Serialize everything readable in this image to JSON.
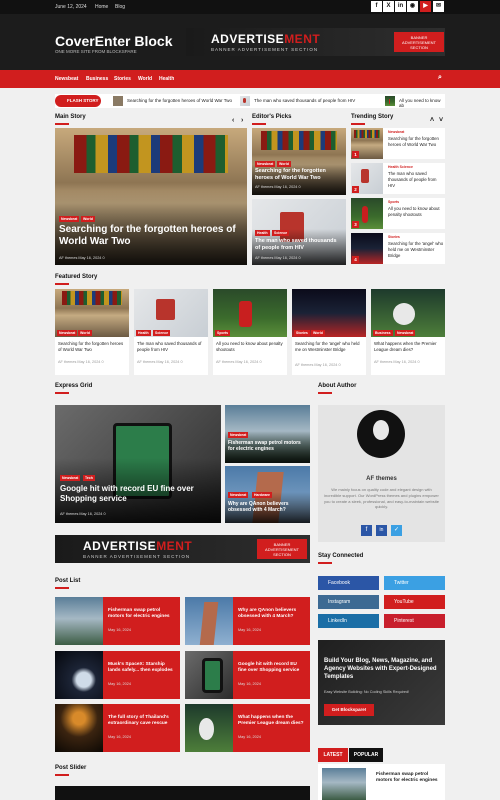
{
  "topbar": {
    "date": "June 12, 2024",
    "links": [
      "Home",
      "Blog"
    ],
    "social": [
      "f",
      "X",
      "in",
      "◉",
      "▶",
      "✉"
    ]
  },
  "site": {
    "title": "CoverEnter Block",
    "tagline": "ONE MORE SITE FROM BLOCKSPARE"
  },
  "ad": {
    "word1": "ADVERTISE",
    "word2": "MENT",
    "sub": "BANNER ADVERTISEMENT SECTION",
    "badge": "BANNER ADVERTISEMENT SECTION"
  },
  "nav": {
    "items": [
      "Newsbeat",
      "Business",
      "Stories",
      "World",
      "Health"
    ]
  },
  "ticker": {
    "label": "FLASH STORY",
    "items": [
      "Searching for the forgotten heroes of World War Two",
      "The man who saved thousands of people from HIV",
      "All you need to know ab"
    ]
  },
  "sections": {
    "main_story": "Main Story",
    "editors_picks": "Editor's Picks",
    "trending": "Trending Story",
    "featured": "Featured Story",
    "express": "Express Grid",
    "about": "About Author",
    "stay": "Stay Connected",
    "post_list": "Post List",
    "post_slider": "Post Slider"
  },
  "main_story": {
    "tags": [
      "Newsbeat",
      "World"
    ],
    "title": "Searching for the forgotten heroes of World War Two",
    "meta": "AF themes   May 16, 2024   0"
  },
  "editors": [
    {
      "tags": [
        "Newsbeat",
        "World"
      ],
      "title": "Searching for the forgotten heroes of World War Two",
      "meta": "AF themes   May 16, 2024   0"
    },
    {
      "tags": [
        "Health",
        "Science"
      ],
      "title": "The man who saved thousands of people from HIV",
      "meta": "AF themes   May 16, 2024   0"
    }
  ],
  "trending": [
    {
      "num": "1",
      "tag": "Newsbeat",
      "title": "Searching for the forgotten heroes of World War Two"
    },
    {
      "num": "2",
      "tag": "Health Science",
      "title": "The man who saved thousands of people from HIV"
    },
    {
      "num": "3",
      "tag": "Sports",
      "title": "All you need to know about penalty shootouts"
    },
    {
      "num": "4",
      "tag": "Stories",
      "title": "Searching for the 'angel' who held me on Westminster Bridge"
    }
  ],
  "featured": [
    {
      "tags": [
        "Newsbeat",
        "World"
      ],
      "title": "Searching for the forgotten heroes of World War Two",
      "meta": "AF themes   May 16, 2024   0"
    },
    {
      "tags": [
        "Health",
        "Science"
      ],
      "title": "The man who saved thousands of people from HIV",
      "meta": "AF themes   May 16, 2024   0"
    },
    {
      "tags": [
        "Sports"
      ],
      "title": "All you need to know about penalty shootouts",
      "meta": "AF themes   May 16, 2024   0"
    },
    {
      "tags": [
        "Stories",
        "World"
      ],
      "title": "Searching for the 'angel' who held me on Westminster Bridge",
      "meta": "AF themes   May 16, 2024   0"
    },
    {
      "tags": [
        "Business",
        "Newsbeat"
      ],
      "title": "What happens when the Premier League dream dies?",
      "meta": "AF themes   May 16, 2024   0"
    }
  ],
  "express": {
    "main": {
      "tags": [
        "Newsbeat",
        "Tech"
      ],
      "title": "Google hit with record EU fine over Shopping service",
      "meta": "AF themes   May 16, 2024   0"
    },
    "side": [
      {
        "tags": [
          "Newsbeat"
        ],
        "title": "Fisherman swap petrol motors for electric engines"
      },
      {
        "tags": [
          "Newsbeat",
          "Hardware"
        ],
        "title": "Why are QAnon believers obsessed with 4 March?"
      }
    ]
  },
  "author": {
    "name": "AF themes",
    "bio": "We mainly focus on quality code and elegant design with incredible support. Our WordPress themes and plugins empower you to create a sleek, professional, and easy-to-maintain website quickly."
  },
  "stay": {
    "buttons": [
      "Facebook",
      "Twitter",
      "Instagram",
      "YouTube",
      "LinkedIn",
      "Pinterest"
    ]
  },
  "promo": {
    "title": "Build Your Blog, News, Magazine, and Agency Websites with Expert-Designed Templates",
    "sub": "Easy Website Building: No Coding Skills Required!",
    "cta": "Get Blockspare!"
  },
  "post_list": [
    {
      "title": "Fisherman swap petrol motors for electric engines",
      "meta": "May 16, 2024"
    },
    {
      "title": "Why are QAnon believers obsessed with 4 March?",
      "meta": "May 16, 2024"
    },
    {
      "title": "Musk's SpaceX: Starship lands safely... then explodes",
      "meta": "May 16, 2024"
    },
    {
      "title": "Google hit with record EU fine over Shopping service",
      "meta": "May 16, 2024"
    },
    {
      "title": "The full story of Thailand's extraordinary cave rescue",
      "meta": "May 16, 2024"
    },
    {
      "title": "What happens when the Premier League dream dies?",
      "meta": "May 16, 2024"
    }
  ],
  "tabs": {
    "latest": "LATEST",
    "popular": "POPULAR",
    "item": "Fisherman swap petrol motors for electric engines"
  },
  "colors": {
    "accent": "#d11e1e",
    "dark": "#1c1c1c"
  }
}
